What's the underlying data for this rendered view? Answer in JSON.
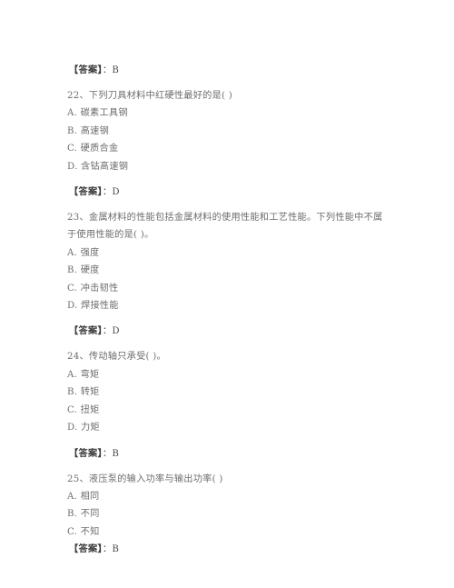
{
  "document": {
    "type": "exam-question-sheet",
    "language": "zh-CN",
    "text_color": "#6d6d6d",
    "background_color": "#ffffff",
    "blocks": [
      {
        "kind": "answer",
        "label": "【答案】",
        "separator": "：",
        "value": "B"
      },
      {
        "kind": "question",
        "number": "22",
        "stem": "22、下列刀具材料中红硬性最好的是(    )",
        "options": [
          "A. 碳素工具钢",
          "B. 高速钢",
          "C. 硬质合金",
          "D. 含钴高速钢"
        ]
      },
      {
        "kind": "answer",
        "label": "【答案】",
        "separator": "：",
        "value": "D"
      },
      {
        "kind": "question",
        "number": "23",
        "stem": "23、金属材料的性能包括金属材料的使用性能和工艺性能。下列性能中不属于使用性能的是(    )。",
        "options": [
          "A. 强度",
          "B. 硬度",
          "C. 冲击韧性",
          "D. 焊接性能"
        ]
      },
      {
        "kind": "answer",
        "label": "【答案】",
        "separator": "：",
        "value": "D"
      },
      {
        "kind": "question",
        "number": "24",
        "stem": "24、传动轴只承受(    )。",
        "options": [
          "A. 弯矩",
          "B. 转矩",
          "C. 扭矩",
          "D. 力矩"
        ]
      },
      {
        "kind": "answer",
        "label": "【答案】",
        "separator": "：",
        "value": "B"
      },
      {
        "kind": "question",
        "number": "25",
        "stem": "25、液压泵的输入功率与输出功率(    )",
        "options": [
          "A. 相同",
          "B. 不同",
          "C. 不知"
        ]
      },
      {
        "kind": "answer",
        "label": "【答案】",
        "separator": "：",
        "value": "B",
        "tight": true
      }
    ]
  }
}
